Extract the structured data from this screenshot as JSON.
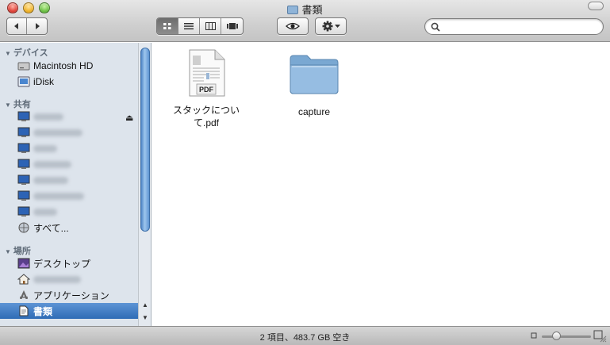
{
  "window": {
    "title": "書類"
  },
  "search": {
    "value": "",
    "placeholder": ""
  },
  "sidebar": {
    "devices_header": "デバイス",
    "shared_header": "共有",
    "places_header": "場所",
    "devices": [
      {
        "label": "Macintosh HD",
        "icon": "hard-disk-icon"
      },
      {
        "label": "iDisk",
        "icon": "idisk-icon"
      }
    ],
    "shared_all_label": "すべて...",
    "places": [
      {
        "label": "デスクトップ",
        "icon": "desktop-icon"
      },
      {
        "label": "",
        "icon": "home-icon"
      },
      {
        "label": "アプリケーション",
        "icon": "applications-icon"
      },
      {
        "label": "書類",
        "icon": "documents-icon",
        "selected": true
      }
    ]
  },
  "files": [
    {
      "name": "スタックについて.pdf",
      "line1": "スタックについ",
      "line2": "て.pdf",
      "badge": "PDF",
      "icon": "pdf-document-icon"
    },
    {
      "name": "capture",
      "line1": "capture",
      "line2": "",
      "icon": "folder-icon"
    }
  ],
  "status": {
    "text": "2 項目、483.7 GB 空き",
    "icon_size_level": 0.25
  },
  "colors": {
    "selection": "#3a75bd",
    "sidebar_bg": "#dde4ec",
    "folder": "#8fb4d8"
  }
}
